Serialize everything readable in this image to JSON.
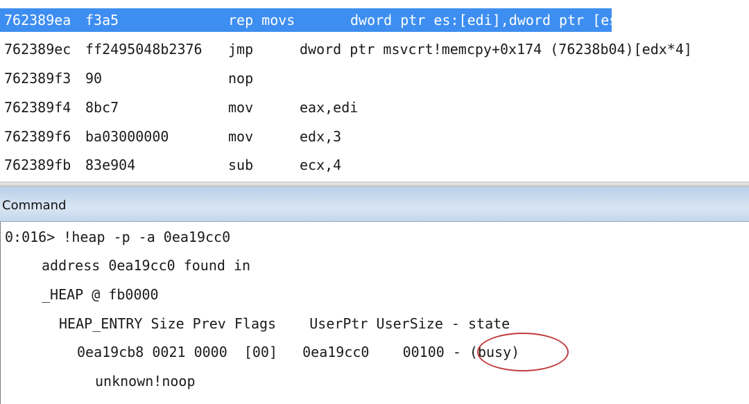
{
  "disassembly": {
    "rows": [
      {
        "addr": "762389ea",
        "bytes": "f3a5",
        "mnemonic": "rep movs",
        "operands": "dword ptr es:[edi],dword ptr [esi]"
      },
      {
        "addr": "762389ec",
        "bytes": "ff2495048b2376",
        "mnemonic": "jmp",
        "operands": "dword ptr msvcrt!memcpy+0x174 (76238b04)[edx*4]"
      },
      {
        "addr": "762389f3",
        "bytes": "90",
        "mnemonic": "nop",
        "operands": ""
      },
      {
        "addr": "762389f4",
        "bytes": "8bc7",
        "mnemonic": "mov",
        "operands": "eax,edi"
      },
      {
        "addr": "762389f6",
        "bytes": "ba03000000",
        "mnemonic": "mov",
        "operands": "edx,3"
      },
      {
        "addr": "762389fb",
        "bytes": "83e904",
        "mnemonic": "sub",
        "operands": "ecx,4"
      }
    ],
    "highlight_color": "#3d8ef0"
  },
  "command_window": {
    "title": "Command",
    "lines": [
      "0:016> !heap -p -a 0ea19cc0",
      "address 0ea19cc0 found in",
      "_HEAP @ fb0000",
      "HEAP_ENTRY Size Prev Flags    UserPtr UserSize - state",
      "0ea19cb8 0021 0000  [00]   0ea19cc0    00100 - (busy)",
      "unknown!noop"
    ],
    "annotation_color": "#c0393b"
  }
}
